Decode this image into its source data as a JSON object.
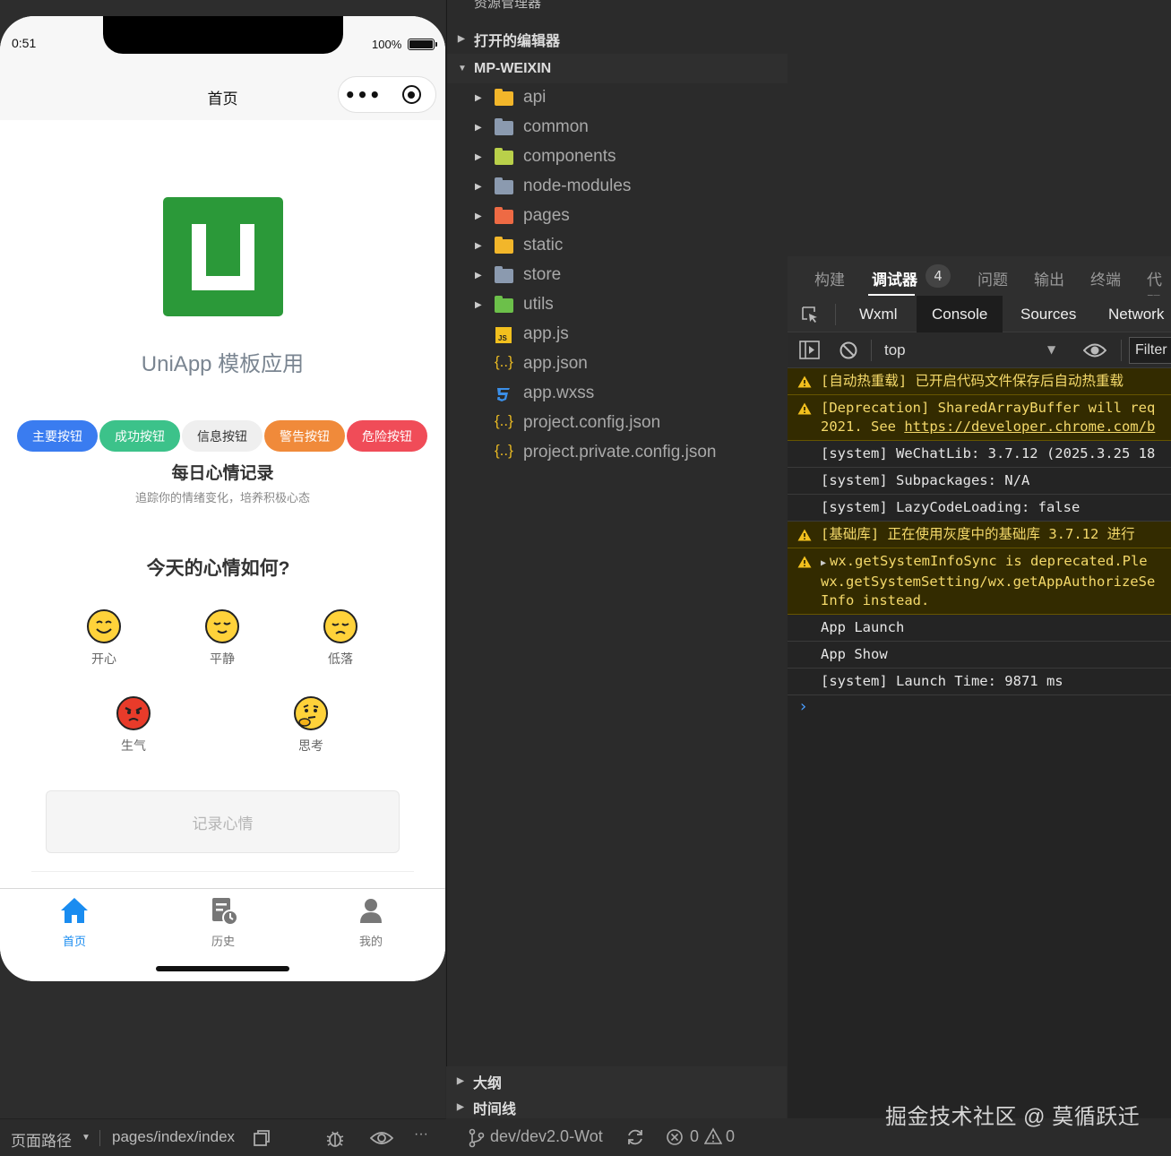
{
  "phone": {
    "status_time": "0:51",
    "battery": "100%",
    "nav_title": "首页",
    "capsule_more": "•••",
    "app_title": "UniApp 模板应用",
    "buttons": [
      "主要按钮",
      "成功按钮",
      "信息按钮",
      "警告按钮",
      "危险按钮"
    ],
    "mood_title": "每日心情记录",
    "mood_subtitle": "追踪你的情绪变化，培养积极心态",
    "mood_question": "今天的心情如何?",
    "moods": [
      {
        "label": "开心",
        "icon": "smile-face-icon"
      },
      {
        "label": "平静",
        "icon": "calm-face-icon"
      },
      {
        "label": "低落",
        "icon": "sad-face-icon"
      },
      {
        "label": "生气",
        "icon": "angry-face-icon"
      },
      {
        "label": "思考",
        "icon": "thinking-face-icon"
      }
    ],
    "record_button": "记录心情",
    "tabs": [
      {
        "label": "首页",
        "icon": "home-icon",
        "active": true
      },
      {
        "label": "历史",
        "icon": "history-icon",
        "active": false
      },
      {
        "label": "我的",
        "icon": "user-icon",
        "active": false
      }
    ],
    "colors": {
      "logo_green": "#2b9939",
      "primary": "#3a7cf0",
      "success": "#3cc28a",
      "warning": "#f08a3a",
      "danger": "#f04c58",
      "tab_active": "#1a8cf0"
    }
  },
  "explorer": {
    "header": "资源管理器",
    "header_more": "···",
    "open_editors": "打开的编辑器",
    "project": "MP-WEIXIN",
    "items": [
      {
        "name": "api",
        "type": "folder"
      },
      {
        "name": "common",
        "type": "folder"
      },
      {
        "name": "components",
        "type": "folder"
      },
      {
        "name": "node-modules",
        "type": "folder"
      },
      {
        "name": "pages",
        "type": "folder"
      },
      {
        "name": "static",
        "type": "folder"
      },
      {
        "name": "store",
        "type": "folder"
      },
      {
        "name": "utils",
        "type": "folder"
      },
      {
        "name": "app.js",
        "type": "js"
      },
      {
        "name": "app.json",
        "type": "json"
      },
      {
        "name": "app.wxss",
        "type": "css"
      },
      {
        "name": "project.config.json",
        "type": "json"
      },
      {
        "name": "project.private.config.json",
        "type": "json"
      }
    ],
    "outline": "大纲",
    "timeline": "时间线"
  },
  "devtools": {
    "main_tabs": [
      "构建",
      "调试器",
      "问题",
      "输出",
      "终端",
      "代码"
    ],
    "badge": "4",
    "sub_tabs": [
      "Wxml",
      "Console",
      "Sources",
      "Network"
    ],
    "context": "top",
    "filter": "Filter",
    "logs": [
      {
        "level": "warn",
        "lines": [
          "[自动热重载] 已开启代码文件保存后自动热重载"
        ]
      },
      {
        "level": "warn",
        "lines": [
          "[Deprecation] SharedArrayBuffer will req"
        ],
        "line2_prefix": "2021. See ",
        "line2_link": "https://developer.chrome.com/b"
      },
      {
        "level": "info",
        "lines": [
          "[system] WeChatLib: 3.7.12 (2025.3.25 18"
        ]
      },
      {
        "level": "info",
        "lines": [
          "[system] Subpackages: N/A"
        ]
      },
      {
        "level": "info",
        "lines": [
          "[system] LazyCodeLoading: false"
        ]
      },
      {
        "level": "warn",
        "lines": [
          "[基础库] 正在使用灰度中的基础库 3.7.12 进行"
        ]
      },
      {
        "level": "warn",
        "expandable": true,
        "lines": [
          "wx.getSystemInfoSync is deprecated.Ple",
          "wx.getSystemSetting/wx.getAppAuthorizeSe",
          "Info instead."
        ]
      },
      {
        "level": "info",
        "lines": [
          "App Launch"
        ]
      },
      {
        "level": "info",
        "lines": [
          "App Show"
        ]
      },
      {
        "level": "info",
        "lines": [
          "[system] Launch Time: 9871 ms"
        ]
      }
    ],
    "prompt": "›"
  },
  "footer": {
    "route_label": "页面路径",
    "route_value": "pages/index/index",
    "more": "···",
    "branch": "dev/dev2.0-Wot",
    "errors": "0",
    "warnings": "0"
  },
  "watermark": "掘金技术社区 @ 莫循跃迁"
}
